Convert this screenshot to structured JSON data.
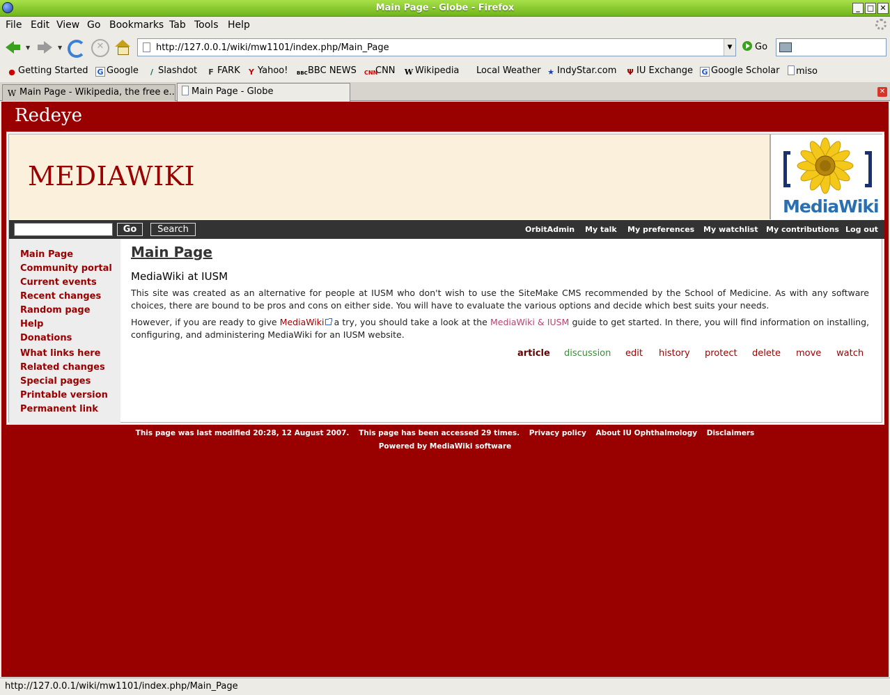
{
  "window": {
    "title": "Main Page - Globe - Firefox"
  },
  "menu": [
    "File",
    "Edit",
    "View",
    "Go",
    "Bookmarks",
    "Tab",
    "Tools",
    "Help"
  ],
  "nav": {
    "url": "http://127.0.0.1/wiki/mw1101/index.php/Main_Page",
    "go_label": "Go"
  },
  "bookmarks": [
    "Getting Started",
    "Google",
    "Slashdot",
    "FARK",
    "Yahoo!",
    "BBC NEWS",
    "CNN",
    "Wikipedia",
    "Local Weather",
    "IndyStar.com",
    "IU Exchange",
    "Google Scholar",
    "miso"
  ],
  "tabs": [
    "Main Page - Wikipedia, the free e...",
    "Main Page - Globe"
  ],
  "site": {
    "name": "Redeye",
    "banner": "MEDIAWIKI",
    "logo_text": "MediaWiki"
  },
  "search": {
    "go": "Go",
    "search": "Search"
  },
  "personal": [
    "OrbitAdmin",
    "My talk",
    "My preferences",
    "My watchlist",
    "My contributions",
    "Log out"
  ],
  "sidebar": [
    "Main Page",
    "Community portal",
    "Current events",
    "Recent changes",
    "Random page",
    "Help",
    "Donations",
    "What links here",
    "Related changes",
    "Special pages",
    "Printable version",
    "Permanent link"
  ],
  "content": {
    "title": "Main Page",
    "section": "MediaWiki at IUSM",
    "p1": "This site was created as an alternative for people at IUSM who don't wish to use the SiteMake CMS recommended by the School of Medicine. As with any software choices, there are bound to be pros and cons on either side. You will have to evaluate the various options and decide which best suits your needs.",
    "p2_a": "However, if you are ready to give ",
    "p2_link1": "MediaWiki",
    "p2_b": " a try, you should take a look at the ",
    "p2_link2": "MediaWiki & IUSM",
    "p2_c": " guide to get started. In there, you will find information on installing, configuring, and administering MediaWiki for an IUSM website."
  },
  "actions": [
    "article",
    "discussion",
    "edit",
    "history",
    "protect",
    "delete",
    "move",
    "watch"
  ],
  "footer": {
    "modified": "This page was last modified 20:28, 12 August 2007.",
    "accessed": "This page has been accessed 29 times.",
    "privacy": "Privacy policy",
    "about": "About IU Ophthalmology",
    "disclaimers": "Disclaimers",
    "powered": "Powered by MediaWiki software"
  },
  "status": {
    "text": "http://127.0.0.1/wiki/mw1101/index.php/Main_Page"
  }
}
